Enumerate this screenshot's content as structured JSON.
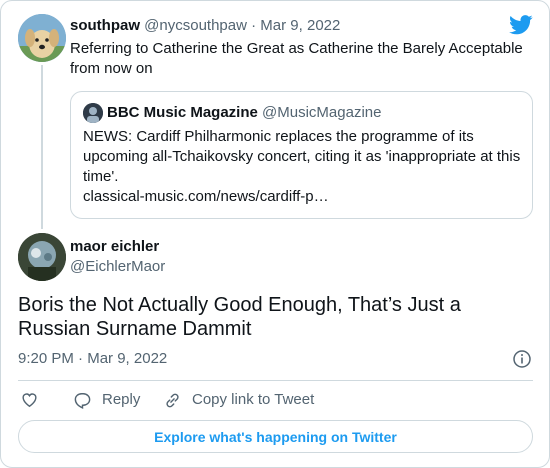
{
  "colors": {
    "accent": "#1d9bf0",
    "text": "#0f1419",
    "muted": "#536471",
    "border": "#cfd9de"
  },
  "parent_tweet": {
    "name": "southpaw",
    "handle": "@nycsouthpaw",
    "separator": "·",
    "date": "Mar 9, 2022",
    "text": "Referring to Catherine the Great as Catherine the Barely Acceptable from now on",
    "avatar_icon": "dog-avatar"
  },
  "quoted_tweet": {
    "name": "BBC Music Magazine",
    "handle": "@MusicMagazine",
    "text": "NEWS: Cardiff Philharmonic replaces the programme of its upcoming all-Tchaikovsky concert, citing it as 'inappropriate at this time'.",
    "link": "classical-music.com/news/cardiff-p…",
    "avatar_icon": "bbc-music-avatar"
  },
  "main_tweet": {
    "name": "maor eichler",
    "handle": "@EichlerMaor",
    "text": "Boris the Not Actually Good Enough, That’s Just a Russian Surname Dammit",
    "time": "9:20 PM",
    "separator": "·",
    "date": "Mar 9, 2022",
    "avatar_icon": "user-avatar"
  },
  "actions": {
    "like_icon": "heart-icon",
    "reply_label": "Reply",
    "copy_label": "Copy link to Tweet"
  },
  "explore_label": "Explore what's happening on Twitter",
  "brand_icon": "twitter-bird-icon"
}
